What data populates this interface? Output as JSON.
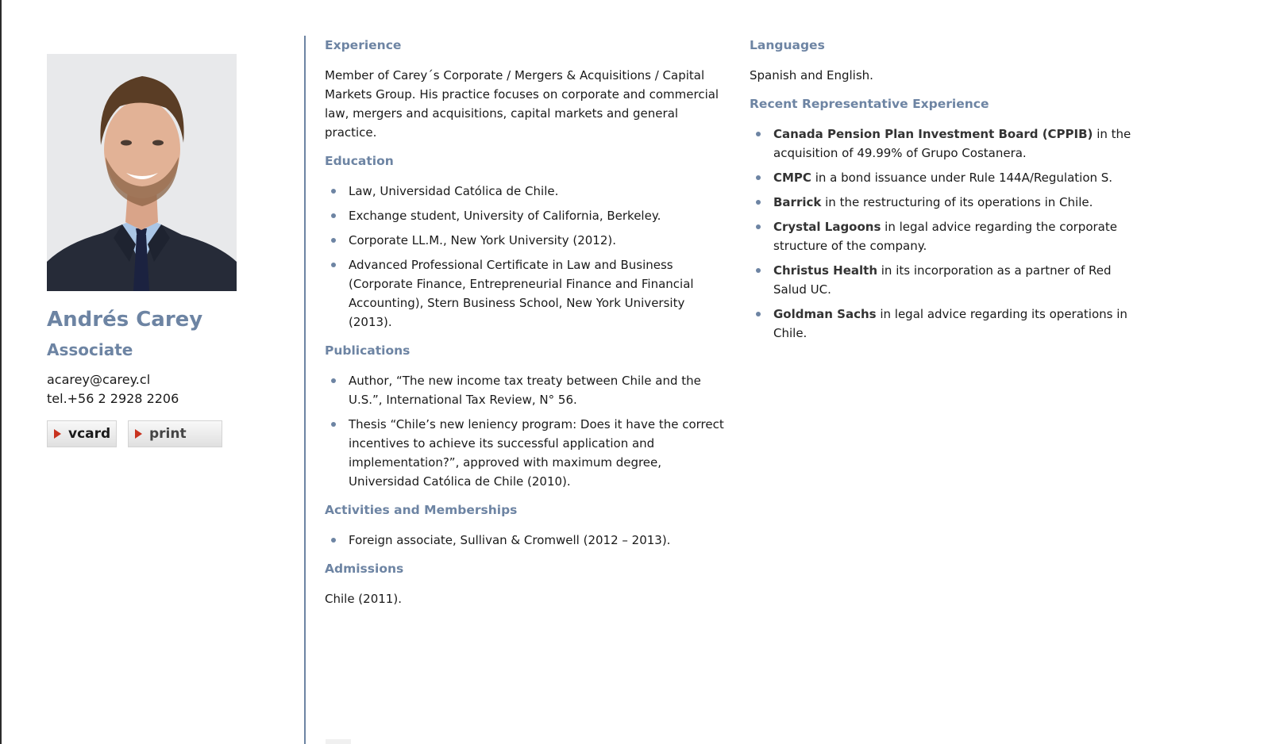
{
  "profile": {
    "name": "Andrés Carey",
    "title": "Associate",
    "email": "acarey@carey.cl",
    "phone": "tel.+56 2 2928 2206",
    "buttons": {
      "vcard": "vcard",
      "print": "print"
    }
  },
  "sections": {
    "experience": {
      "heading": "Experience",
      "text": "Member of Carey´s Corporate / Mergers & Acquisitions  / Capital Markets Group. His practice focuses on corporate and commercial law, mergers and acquisitions, capital markets and general practice."
    },
    "education": {
      "heading": "Education",
      "items": [
        "Law, Universidad Católica de Chile.",
        "Exchange student, University of California, Berkeley.",
        "Corporate LL.M., New York University (2012).",
        "Advanced Professional Certificate in Law and Business (Corporate Finance, Entrepreneurial Finance and Financial Accounting), Stern Business School, New York University (2013)."
      ]
    },
    "publications": {
      "heading": "Publications",
      "items": [
        "Author, “The new income tax treaty between Chile and the U.S.”, International Tax Review, N° 56.",
        "Thesis “Chile’s new leniency program: Does it have the correct incentives to achieve its successful application and implementation?”, approved with maximum degree, Universidad Católica de Chile (2010)."
      ]
    },
    "activities": {
      "heading": "Activities and Memberships",
      "items": [
        "Foreign associate, Sullivan & Cromwell (2012 – 2013)."
      ]
    },
    "admissions": {
      "heading": "Admissions",
      "text": "Chile (2011)."
    },
    "languages": {
      "heading": "Languages",
      "text": "Spanish and English."
    },
    "recent": {
      "heading": "Recent Representative Experience",
      "items": [
        {
          "client": "Canada Pension Plan Investment Board (CPPIB)",
          "text": " in the acquisition of 49.99% of Grupo Costanera."
        },
        {
          "client": "CMPC",
          "text": " in a bond issuance under Rule 144A/Regulation S."
        },
        {
          "client": "Barrick",
          "text": " in the restructuring of its operations in Chile."
        },
        {
          "client": "Crystal Lagoons",
          "text": " in legal advice regarding the corporate structure of the company."
        },
        {
          "client": "Christus Health",
          "text": " in its incorporation as a partner of Red Salud UC."
        },
        {
          "client": "Goldman Sachs",
          "text": " in legal advice regarding its operations in Chile."
        }
      ]
    }
  },
  "colors": {
    "accent": "#6d84a3",
    "button_arrow": "#c8321e",
    "frame": "#2b2b2b"
  }
}
